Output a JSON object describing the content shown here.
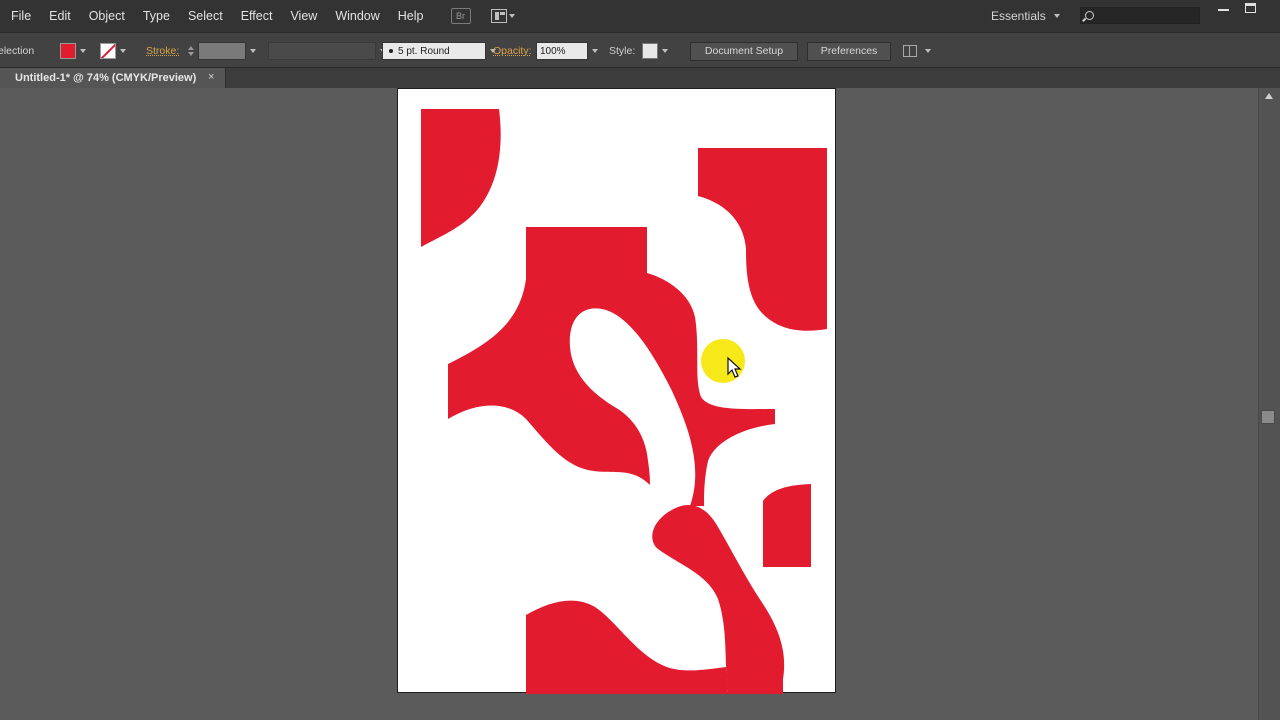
{
  "menubar": {
    "items": [
      "File",
      "Edit",
      "Object",
      "Type",
      "Select",
      "Effect",
      "View",
      "Window",
      "Help"
    ],
    "bridge_label": "Br",
    "workspace_label": "Essentials"
  },
  "controlbar": {
    "selection_label": "election",
    "fill_color": "#e31b2f",
    "stroke_label": "Stroke:",
    "brush_label": "5 pt. Round",
    "opacity_label": "Opacity:",
    "opacity_value": "100%",
    "style_label": "Style:",
    "document_setup_label": "Document Setup",
    "preferences_label": "Preferences"
  },
  "document": {
    "tab_title": "Untitled-1* @ 74% (CMYK/Preview)",
    "close_glyph": "×"
  },
  "artwork": {
    "shape_color": "#e31b2f",
    "highlight_color": "#f5e600"
  }
}
